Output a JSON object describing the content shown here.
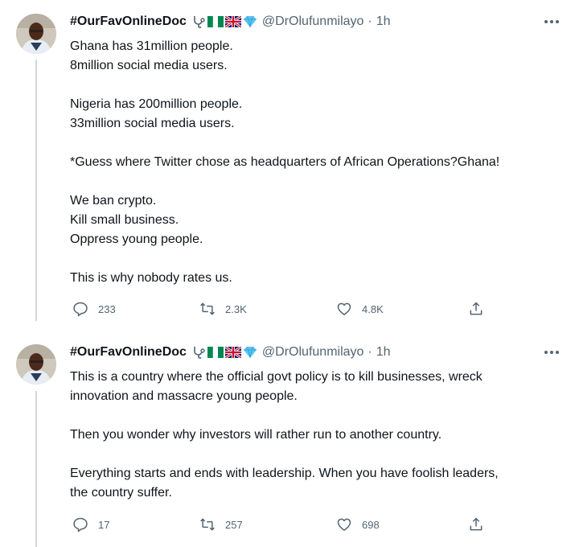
{
  "tweets": [
    {
      "display_name": "#OurFavOnlineDoc",
      "handle": "@DrOlufunmilayo",
      "separator": "·",
      "time": "1h",
      "badges": [
        "stethoscope-emoji",
        "nigeria-flag-emoji",
        "uk-flag-emoji",
        "gem-emoji"
      ],
      "paragraphs": [
        [
          "Ghana has 31million people.",
          "8million social media users."
        ],
        [
          "Nigeria has 200million people.",
          "33million social media users."
        ],
        [
          "*Guess where Twitter chose as headquarters of African Operations?Ghana!"
        ],
        [
          "We ban crypto.",
          "Kill small business.",
          "Oppress young people."
        ],
        [
          "This is why nobody rates us."
        ]
      ],
      "replies": "233",
      "retweets": "2.3K",
      "likes": "4.8K"
    },
    {
      "display_name": "#OurFavOnlineDoc",
      "handle": "@DrOlufunmilayo",
      "separator": "·",
      "time": "1h",
      "badges": [
        "stethoscope-emoji",
        "nigeria-flag-emoji",
        "uk-flag-emoji",
        "gem-emoji"
      ],
      "paragraphs": [
        [
          "This is a country where the official govt policy is to kill businesses, wreck",
          "innovation and massacre young people."
        ],
        [
          "Then you wonder why investors will rather run to another country."
        ],
        [
          "Everything starts and ends with leadership. When you have foolish leaders,",
          "the country suffer."
        ]
      ],
      "replies": "17",
      "retweets": "257",
      "likes": "698"
    }
  ],
  "colors": {
    "text": "#0f1419",
    "secondary": "#536471",
    "thread_line": "#cfd9de",
    "gem": "#5cc4f0",
    "nigeria_green": "#008751",
    "uk_blue": "#012169",
    "uk_red": "#c8102e"
  }
}
